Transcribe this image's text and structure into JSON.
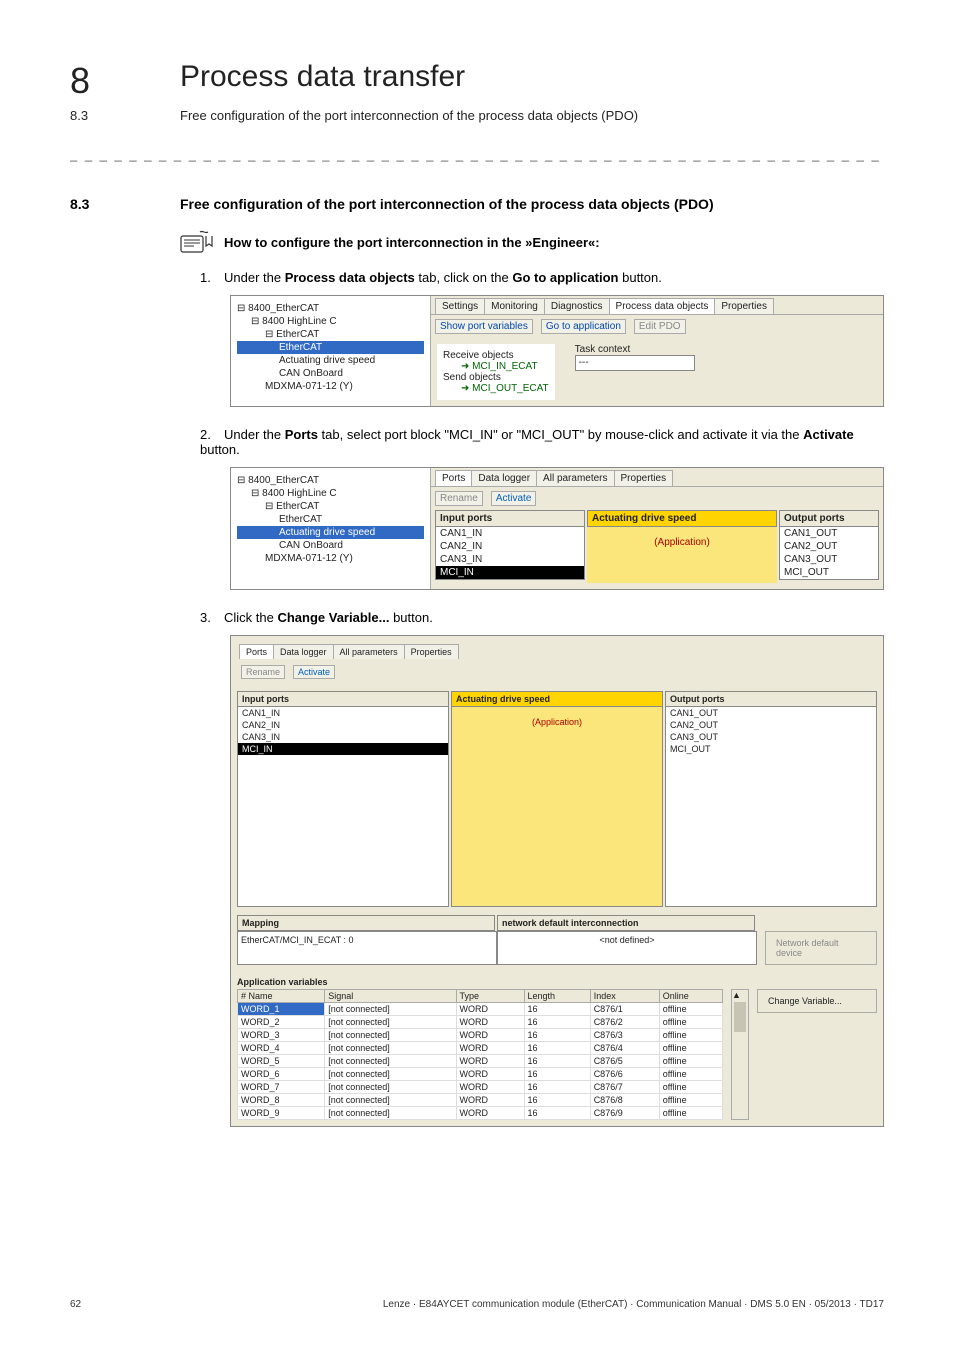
{
  "header": {
    "chapter_num": "8",
    "chapter_title": "Process data transfer",
    "sub_num": "8.3",
    "sub_title": "Free configuration of the port interconnection of the process data objects (PDO)"
  },
  "section": {
    "num": "8.3",
    "title": "Free configuration of the port interconnection of the process data objects (PDO)"
  },
  "note": "How to configure the port interconnection in the »Engineer«:",
  "steps": {
    "s1_pre": "Under the ",
    "s1_b1": "Process data objects",
    "s1_mid": " tab, click on the ",
    "s1_b2": "Go to application",
    "s1_post": " button.",
    "s2_pre": "Under the ",
    "s2_b1": "Ports",
    "s2_mid": " tab, select port block \"MCI_IN\" or \"MCI_OUT\" by mouse-click and activate it via the ",
    "s2_b2": "Activate",
    "s2_post": " button.",
    "s3_pre": "Click the ",
    "s3_b1": "Change Variable...",
    "s3_post": " button."
  },
  "shot1": {
    "tree": [
      "8400_EtherCAT",
      "8400 HighLine C",
      "EtherCAT",
      "EtherCAT",
      "Actuating drive speed",
      "CAN OnBoard",
      "MDXMA-071-12 (Y)"
    ],
    "tree_hl_index": 3,
    "tabs": [
      "Settings",
      "Monitoring",
      "Diagnostics",
      "Process data objects",
      "Properties"
    ],
    "active_tab": 3,
    "toolbar": {
      "show_port": "Show port variables",
      "go_app": "Go to application",
      "edit_pdo": "Edit PDO"
    },
    "recv_label": "Receive objects",
    "recv_item": "MCI_IN_ECAT",
    "send_label": "Send objects",
    "send_item": "MCI_OUT_ECAT",
    "task_label": "Task context",
    "task_val": "---"
  },
  "shot2": {
    "tree": [
      "8400_EtherCAT",
      "8400 HighLine C",
      "EtherCAT",
      "EtherCAT",
      "Actuating drive speed",
      "CAN OnBoard",
      "MDXMA-071-12 (Y)"
    ],
    "tree_hl_index": 4,
    "tabs": [
      "Ports",
      "Data logger",
      "All parameters",
      "Properties"
    ],
    "active_tab": 0,
    "rename": "Rename",
    "activate": "Activate",
    "input_label": "Input ports",
    "input_ports": [
      "CAN1_IN",
      "CAN2_IN",
      "CAN3_IN",
      "MCI_IN"
    ],
    "mid_label": "Actuating drive speed",
    "app": "(Application)",
    "output_label": "Output ports",
    "output_ports": [
      "CAN1_OUT",
      "CAN2_OUT",
      "CAN3_OUT",
      "MCI_OUT"
    ]
  },
  "shot3": {
    "tabs": [
      "Ports",
      "Data logger",
      "All parameters",
      "Properties"
    ],
    "rename": "Rename",
    "activate": "Activate",
    "input_label": "Input ports",
    "input_ports": [
      "CAN1_IN",
      "CAN2_IN",
      "CAN3_IN",
      "MCI_IN"
    ],
    "mid_label": "Actuating drive speed",
    "app": "(Application)",
    "output_label": "Output ports",
    "output_ports": [
      "CAN1_OUT",
      "CAN2_OUT",
      "CAN3_OUT",
      "MCI_OUT"
    ],
    "mapping_label": "Mapping",
    "network_label": "network default interconnection",
    "mapping_val": "EtherCAT/MCI_IN_ECAT : 0",
    "not_defined": "<not defined>",
    "net_btn": "Network default device",
    "appvar_label": "Application variables",
    "change_btn": "Change Variable...",
    "table": {
      "headers": [
        "# Name",
        "Signal",
        "Type",
        "Length",
        "Index",
        "Online"
      ],
      "rows": [
        [
          "WORD_1",
          "[not connected]",
          "WORD",
          "16",
          "C876/1",
          "offline"
        ],
        [
          "WORD_2",
          "[not connected]",
          "WORD",
          "16",
          "C876/2",
          "offline"
        ],
        [
          "WORD_3",
          "[not connected]",
          "WORD",
          "16",
          "C876/3",
          "offline"
        ],
        [
          "WORD_4",
          "[not connected]",
          "WORD",
          "16",
          "C876/4",
          "offline"
        ],
        [
          "WORD_5",
          "[not connected]",
          "WORD",
          "16",
          "C876/5",
          "offline"
        ],
        [
          "WORD_6",
          "[not connected]",
          "WORD",
          "16",
          "C876/6",
          "offline"
        ],
        [
          "WORD_7",
          "[not connected]",
          "WORD",
          "16",
          "C876/7",
          "offline"
        ],
        [
          "WORD_8",
          "[not connected]",
          "WORD",
          "16",
          "C876/8",
          "offline"
        ],
        [
          "WORD_9",
          "[not connected]",
          "WORD",
          "16",
          "C876/9",
          "offline"
        ]
      ]
    }
  },
  "footer": {
    "page": "62",
    "info": "Lenze · E84AYCET communication module (EtherCAT) · Communication Manual · DMS 5.0 EN · 05/2013 · TD17"
  }
}
